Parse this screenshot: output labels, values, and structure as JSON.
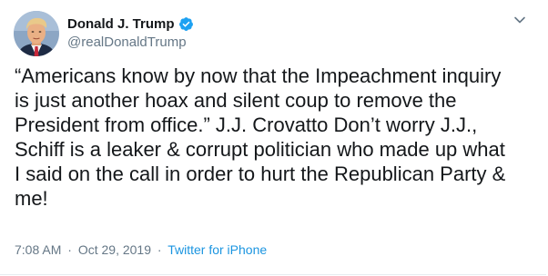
{
  "author": {
    "display_name": "Donald J. Trump",
    "handle": "@realDonaldTrump",
    "verified": true,
    "avatar_icon": "profile-photo",
    "verified_icon": "verified-badge-icon",
    "verified_color": "#1da1f2"
  },
  "tweet": {
    "lines": [
      "“Americans know by now that the Impeachment inquiry",
      "is just another hoax and silent coup to remove the",
      "President from office.” J.J. Crovatto  Don’t worry J.J.,",
      "Schiff is a leaker & corrupt politician who made up what",
      "I said on the call in order to hurt the Republican Party &",
      "me!"
    ]
  },
  "meta": {
    "time": "7:08 AM",
    "separator": "·",
    "date": "Oct 29, 2019",
    "source": "Twitter for iPhone"
  },
  "menu": {
    "icon": "chevron-down-icon"
  },
  "colors": {
    "text": "#14171a",
    "secondary": "#657786",
    "link": "#1b95e0",
    "border": "#e6ecf0"
  }
}
